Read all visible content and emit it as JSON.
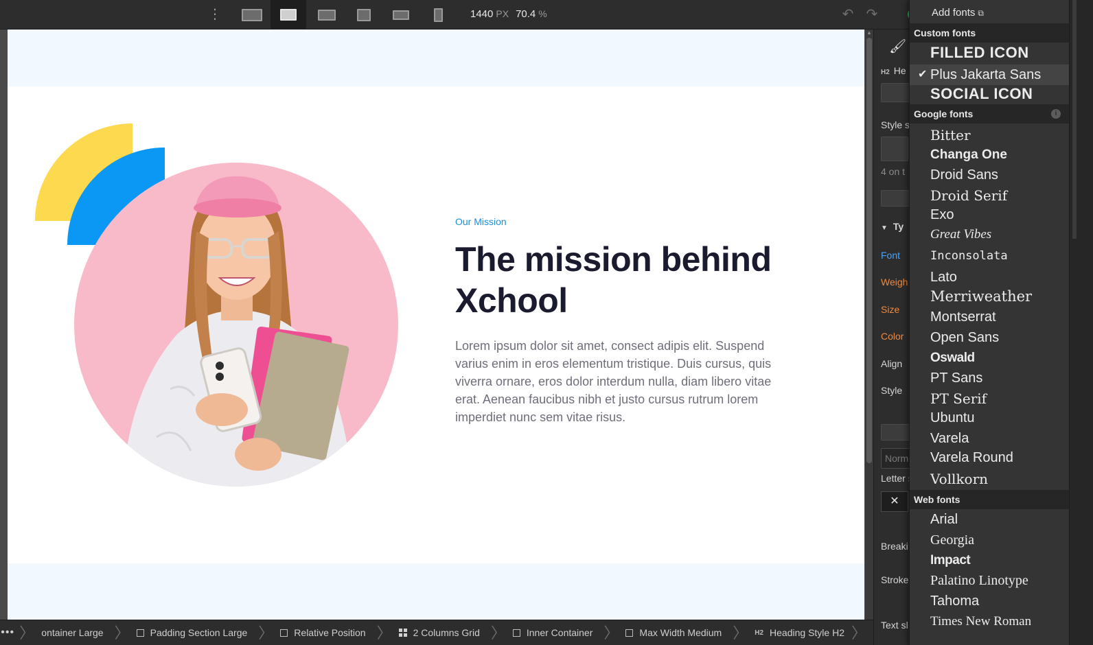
{
  "toolbar": {
    "more_icon": "vertical-ellipsis-icon",
    "breakpoints": [
      {
        "name": "desktop-large-breakpoint"
      },
      {
        "name": "desktop-breakpoint",
        "active": true
      },
      {
        "name": "desktop-base-breakpoint"
      },
      {
        "name": "tablet-breakpoint"
      },
      {
        "name": "mobile-landscape-breakpoint"
      },
      {
        "name": "mobile-portrait-breakpoint"
      }
    ],
    "width_value": "1440",
    "width_unit": "PX",
    "zoom_value": "70.4",
    "zoom_unit": "%",
    "undo_icon": "undo-icon",
    "redo_icon": "redo-icon"
  },
  "canvas": {
    "eyebrow": "Our Mission",
    "headline": "The mission behind Xchool",
    "body": "Lorem ipsum dolor sit amet, consect adipis elit. Suspend varius enim in eros elementum tristique. Duis cursus, quis viverra ornare, eros dolor interdum nulla, diam libero vitae erat. Aenean faucibus nibh et justo cursus rutrum lorem imperdiet nunc sem vitae risus.",
    "colors": {
      "band": "#f1f8fe",
      "yellow_shape": "#fdd94f",
      "blue_shape": "#0b97f4",
      "photo_bg": "#f8b9c8",
      "eyebrow": "#1a8fdc",
      "headline": "#1b1b2f",
      "body": "#6e6e7a"
    }
  },
  "breadcrumbs": {
    "more_label": "•••",
    "items": [
      {
        "label": "ontainer Large",
        "icon": "none"
      },
      {
        "label": "Padding Section Large",
        "icon": "box-icon"
      },
      {
        "label": "Relative Position",
        "icon": "box-icon"
      },
      {
        "label": "2 Columns Grid",
        "icon": "grid-icon"
      },
      {
        "label": "Inner Container",
        "icon": "box-icon"
      },
      {
        "label": "Max Width Medium",
        "icon": "box-icon"
      },
      {
        "label": "Heading Style H2",
        "icon": "h2-icon",
        "icon_text": "H2"
      }
    ]
  },
  "right_panel": {
    "heading_tag": "H2",
    "heading_label": "He",
    "style_label": "Style s",
    "on_this_page": "4 on t",
    "typography_label": "Ty",
    "font_label": "Font",
    "weight_label": "Weigh",
    "size_label": "Size",
    "color_label": "Color",
    "align_label": "Align",
    "style2_label": "Style",
    "normal_placeholder": "Norm",
    "letter_label": "Letter s",
    "close_label": "✕",
    "breaking_label": "Breaki",
    "stroke_label": "Stroke",
    "text_label": "Text sl"
  },
  "font_menu": {
    "add_fonts": "Add fonts",
    "custom_header": "Custom fonts",
    "custom_fonts": [
      "FILLED ICON",
      "Plus Jakarta Sans",
      "SOCIAL ICON"
    ],
    "selected_font": "Plus Jakarta Sans",
    "google_header": "Google fonts",
    "google_fonts": [
      "Bitter",
      "Changa One",
      "Droid Sans",
      "Droid Serif",
      "Exo",
      "Great Vibes",
      "Inconsolata",
      "Lato",
      "Merriweather",
      "Montserrat",
      "Open Sans",
      "Oswald",
      "PT Sans",
      "PT Serif",
      "Ubuntu",
      "Varela",
      "Varela Round",
      "Vollkorn"
    ],
    "web_header": "Web fonts",
    "web_fonts": [
      "Arial",
      "Georgia",
      "Impact",
      "Palatino Linotype",
      "Tahoma",
      "Times New Roman"
    ]
  }
}
